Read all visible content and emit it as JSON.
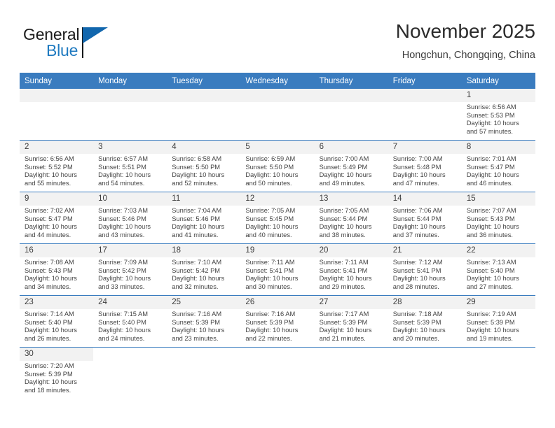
{
  "brand": {
    "name_part1": "General",
    "name_part2": "Blue",
    "flag_icon": "general-blue-flag-logo"
  },
  "header": {
    "month_title": "November 2025",
    "location": "Hongchun, Chongqing, China"
  },
  "theme": {
    "header_blue": "#3a7cbf",
    "brand_blue": "#1f7ac0",
    "daynum_band": "#f2f2f2",
    "text": "#3c3c3c"
  },
  "weekday_headers": [
    "Sunday",
    "Monday",
    "Tuesday",
    "Wednesday",
    "Thursday",
    "Friday",
    "Saturday"
  ],
  "weeks": [
    [
      {
        "day": "",
        "sunrise": "",
        "sunset": "",
        "daylight": "",
        "daylight2": "",
        "blank": true
      },
      {
        "day": "",
        "sunrise": "",
        "sunset": "",
        "daylight": "",
        "daylight2": "",
        "blank": true
      },
      {
        "day": "",
        "sunrise": "",
        "sunset": "",
        "daylight": "",
        "daylight2": "",
        "blank": true
      },
      {
        "day": "",
        "sunrise": "",
        "sunset": "",
        "daylight": "",
        "daylight2": "",
        "blank": true
      },
      {
        "day": "",
        "sunrise": "",
        "sunset": "",
        "daylight": "",
        "daylight2": "",
        "blank": true
      },
      {
        "day": "",
        "sunrise": "",
        "sunset": "",
        "daylight": "",
        "daylight2": "",
        "blank": true
      },
      {
        "day": "1",
        "sunrise": "Sunrise: 6:56 AM",
        "sunset": "Sunset: 5:53 PM",
        "daylight": "Daylight: 10 hours",
        "daylight2": "and 57 minutes."
      }
    ],
    [
      {
        "day": "2",
        "sunrise": "Sunrise: 6:56 AM",
        "sunset": "Sunset: 5:52 PM",
        "daylight": "Daylight: 10 hours",
        "daylight2": "and 55 minutes."
      },
      {
        "day": "3",
        "sunrise": "Sunrise: 6:57 AM",
        "sunset": "Sunset: 5:51 PM",
        "daylight": "Daylight: 10 hours",
        "daylight2": "and 54 minutes."
      },
      {
        "day": "4",
        "sunrise": "Sunrise: 6:58 AM",
        "sunset": "Sunset: 5:50 PM",
        "daylight": "Daylight: 10 hours",
        "daylight2": "and 52 minutes."
      },
      {
        "day": "5",
        "sunrise": "Sunrise: 6:59 AM",
        "sunset": "Sunset: 5:50 PM",
        "daylight": "Daylight: 10 hours",
        "daylight2": "and 50 minutes."
      },
      {
        "day": "6",
        "sunrise": "Sunrise: 7:00 AM",
        "sunset": "Sunset: 5:49 PM",
        "daylight": "Daylight: 10 hours",
        "daylight2": "and 49 minutes."
      },
      {
        "day": "7",
        "sunrise": "Sunrise: 7:00 AM",
        "sunset": "Sunset: 5:48 PM",
        "daylight": "Daylight: 10 hours",
        "daylight2": "and 47 minutes."
      },
      {
        "day": "8",
        "sunrise": "Sunrise: 7:01 AM",
        "sunset": "Sunset: 5:47 PM",
        "daylight": "Daylight: 10 hours",
        "daylight2": "and 46 minutes."
      }
    ],
    [
      {
        "day": "9",
        "sunrise": "Sunrise: 7:02 AM",
        "sunset": "Sunset: 5:47 PM",
        "daylight": "Daylight: 10 hours",
        "daylight2": "and 44 minutes."
      },
      {
        "day": "10",
        "sunrise": "Sunrise: 7:03 AM",
        "sunset": "Sunset: 5:46 PM",
        "daylight": "Daylight: 10 hours",
        "daylight2": "and 43 minutes."
      },
      {
        "day": "11",
        "sunrise": "Sunrise: 7:04 AM",
        "sunset": "Sunset: 5:46 PM",
        "daylight": "Daylight: 10 hours",
        "daylight2": "and 41 minutes."
      },
      {
        "day": "12",
        "sunrise": "Sunrise: 7:05 AM",
        "sunset": "Sunset: 5:45 PM",
        "daylight": "Daylight: 10 hours",
        "daylight2": "and 40 minutes."
      },
      {
        "day": "13",
        "sunrise": "Sunrise: 7:05 AM",
        "sunset": "Sunset: 5:44 PM",
        "daylight": "Daylight: 10 hours",
        "daylight2": "and 38 minutes."
      },
      {
        "day": "14",
        "sunrise": "Sunrise: 7:06 AM",
        "sunset": "Sunset: 5:44 PM",
        "daylight": "Daylight: 10 hours",
        "daylight2": "and 37 minutes."
      },
      {
        "day": "15",
        "sunrise": "Sunrise: 7:07 AM",
        "sunset": "Sunset: 5:43 PM",
        "daylight": "Daylight: 10 hours",
        "daylight2": "and 36 minutes."
      }
    ],
    [
      {
        "day": "16",
        "sunrise": "Sunrise: 7:08 AM",
        "sunset": "Sunset: 5:43 PM",
        "daylight": "Daylight: 10 hours",
        "daylight2": "and 34 minutes."
      },
      {
        "day": "17",
        "sunrise": "Sunrise: 7:09 AM",
        "sunset": "Sunset: 5:42 PM",
        "daylight": "Daylight: 10 hours",
        "daylight2": "and 33 minutes."
      },
      {
        "day": "18",
        "sunrise": "Sunrise: 7:10 AM",
        "sunset": "Sunset: 5:42 PM",
        "daylight": "Daylight: 10 hours",
        "daylight2": "and 32 minutes."
      },
      {
        "day": "19",
        "sunrise": "Sunrise: 7:11 AM",
        "sunset": "Sunset: 5:41 PM",
        "daylight": "Daylight: 10 hours",
        "daylight2": "and 30 minutes."
      },
      {
        "day": "20",
        "sunrise": "Sunrise: 7:11 AM",
        "sunset": "Sunset: 5:41 PM",
        "daylight": "Daylight: 10 hours",
        "daylight2": "and 29 minutes."
      },
      {
        "day": "21",
        "sunrise": "Sunrise: 7:12 AM",
        "sunset": "Sunset: 5:41 PM",
        "daylight": "Daylight: 10 hours",
        "daylight2": "and 28 minutes."
      },
      {
        "day": "22",
        "sunrise": "Sunrise: 7:13 AM",
        "sunset": "Sunset: 5:40 PM",
        "daylight": "Daylight: 10 hours",
        "daylight2": "and 27 minutes."
      }
    ],
    [
      {
        "day": "23",
        "sunrise": "Sunrise: 7:14 AM",
        "sunset": "Sunset: 5:40 PM",
        "daylight": "Daylight: 10 hours",
        "daylight2": "and 26 minutes."
      },
      {
        "day": "24",
        "sunrise": "Sunrise: 7:15 AM",
        "sunset": "Sunset: 5:40 PM",
        "daylight": "Daylight: 10 hours",
        "daylight2": "and 24 minutes."
      },
      {
        "day": "25",
        "sunrise": "Sunrise: 7:16 AM",
        "sunset": "Sunset: 5:39 PM",
        "daylight": "Daylight: 10 hours",
        "daylight2": "and 23 minutes."
      },
      {
        "day": "26",
        "sunrise": "Sunrise: 7:16 AM",
        "sunset": "Sunset: 5:39 PM",
        "daylight": "Daylight: 10 hours",
        "daylight2": "and 22 minutes."
      },
      {
        "day": "27",
        "sunrise": "Sunrise: 7:17 AM",
        "sunset": "Sunset: 5:39 PM",
        "daylight": "Daylight: 10 hours",
        "daylight2": "and 21 minutes."
      },
      {
        "day": "28",
        "sunrise": "Sunrise: 7:18 AM",
        "sunset": "Sunset: 5:39 PM",
        "daylight": "Daylight: 10 hours",
        "daylight2": "and 20 minutes."
      },
      {
        "day": "29",
        "sunrise": "Sunrise: 7:19 AM",
        "sunset": "Sunset: 5:39 PM",
        "daylight": "Daylight: 10 hours",
        "daylight2": "and 19 minutes."
      }
    ],
    [
      {
        "day": "30",
        "sunrise": "Sunrise: 7:20 AM",
        "sunset": "Sunset: 5:39 PM",
        "daylight": "Daylight: 10 hours",
        "daylight2": "and 18 minutes."
      },
      {
        "day": "",
        "sunrise": "",
        "sunset": "",
        "daylight": "",
        "daylight2": "",
        "blank": true,
        "noband": true
      },
      {
        "day": "",
        "sunrise": "",
        "sunset": "",
        "daylight": "",
        "daylight2": "",
        "blank": true,
        "noband": true
      },
      {
        "day": "",
        "sunrise": "",
        "sunset": "",
        "daylight": "",
        "daylight2": "",
        "blank": true,
        "noband": true
      },
      {
        "day": "",
        "sunrise": "",
        "sunset": "",
        "daylight": "",
        "daylight2": "",
        "blank": true,
        "noband": true
      },
      {
        "day": "",
        "sunrise": "",
        "sunset": "",
        "daylight": "",
        "daylight2": "",
        "blank": true,
        "noband": true
      },
      {
        "day": "",
        "sunrise": "",
        "sunset": "",
        "daylight": "",
        "daylight2": "",
        "blank": true,
        "noband": true
      }
    ]
  ]
}
